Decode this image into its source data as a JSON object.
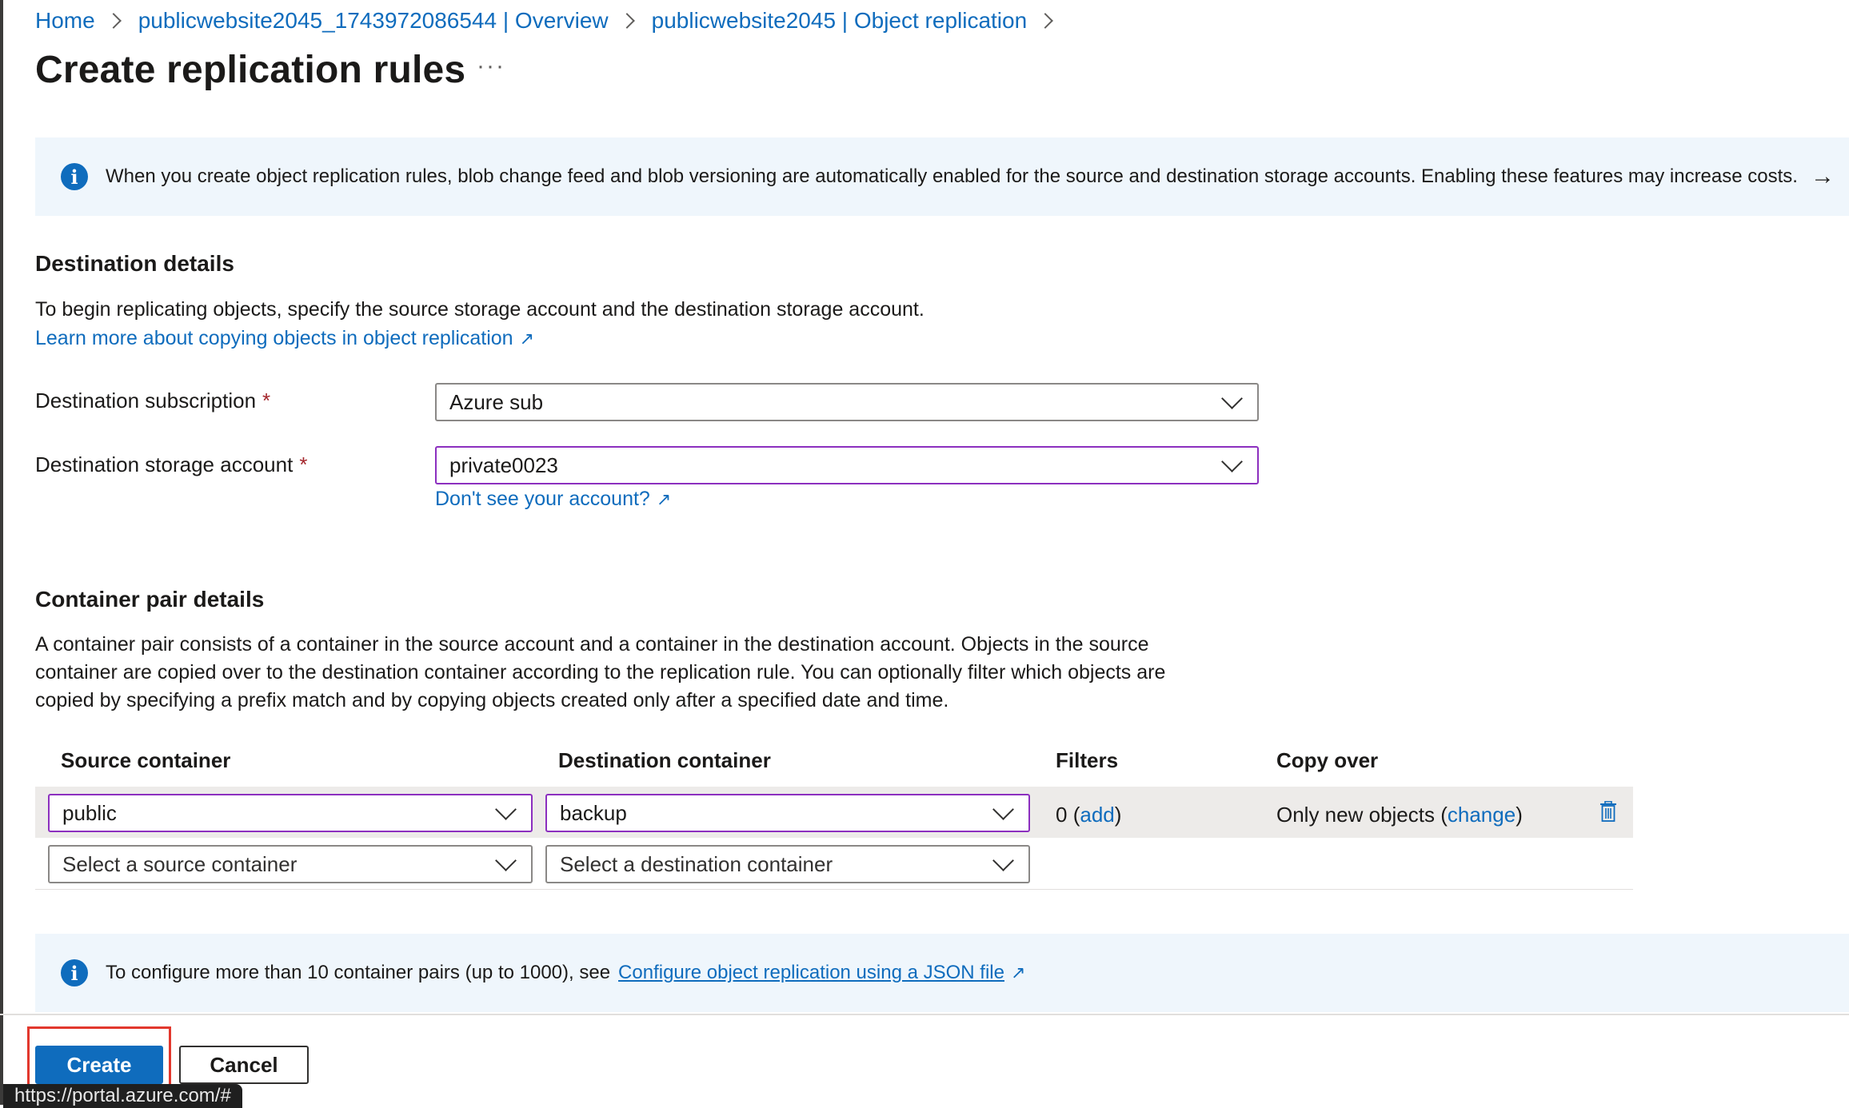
{
  "breadcrumb": {
    "items": [
      "Home",
      "publicwebsite2045_1743972086544 | Overview",
      "publicwebsite2045 | Object replication"
    ]
  },
  "page": {
    "title": "Create replication rules",
    "more_label": "···"
  },
  "top_banner": {
    "text": "When you create object replication rules, blob change feed and blob versioning are automatically enabled for the source and destination storage accounts. Enabling these features may increase costs.",
    "arrow": "→"
  },
  "destination": {
    "title": "Destination details",
    "description": "To begin replicating objects, specify the source storage account and the destination storage account.",
    "learn_more": "Learn more about copying objects in object replication",
    "subscription_label": "Destination subscription",
    "subscription_value": "Azure sub",
    "account_label": "Destination storage account",
    "account_value": "private0023",
    "account_help_link": "Don't see your account?",
    "required_mark": "*"
  },
  "container_pairs": {
    "title": "Container pair details",
    "description_lines": [
      "A container pair consists of a container in the source account and a container in the destination account. Objects in the source",
      "container are copied over to the destination container according to the replication rule. You can optionally filter which objects are",
      "copied by specifying a prefix match and by copying objects created only after a specified date and time."
    ],
    "columns": [
      "Source container",
      "Destination container",
      "Filters",
      "Copy over"
    ],
    "rows": [
      {
        "source": "public",
        "destination": "backup",
        "filters_count": "0",
        "filters_add": "add",
        "copy_over": "Only new objects",
        "copy_change": "change"
      }
    ],
    "new_row": {
      "source_placeholder": "Select a source container",
      "destination_placeholder": "Select a destination container"
    }
  },
  "bottom_banner": {
    "text": "To configure more than 10 container pairs (up to 1000), see",
    "link": "Configure object replication using a JSON file"
  },
  "footer": {
    "create_label": "Create",
    "cancel_label": "Cancel"
  },
  "status_bar": {
    "url": "https://portal.azure.com/#"
  },
  "colors": {
    "accent": "#0f6cbd",
    "focus_border": "#8c2fbf",
    "highlight": "#e2382d"
  }
}
